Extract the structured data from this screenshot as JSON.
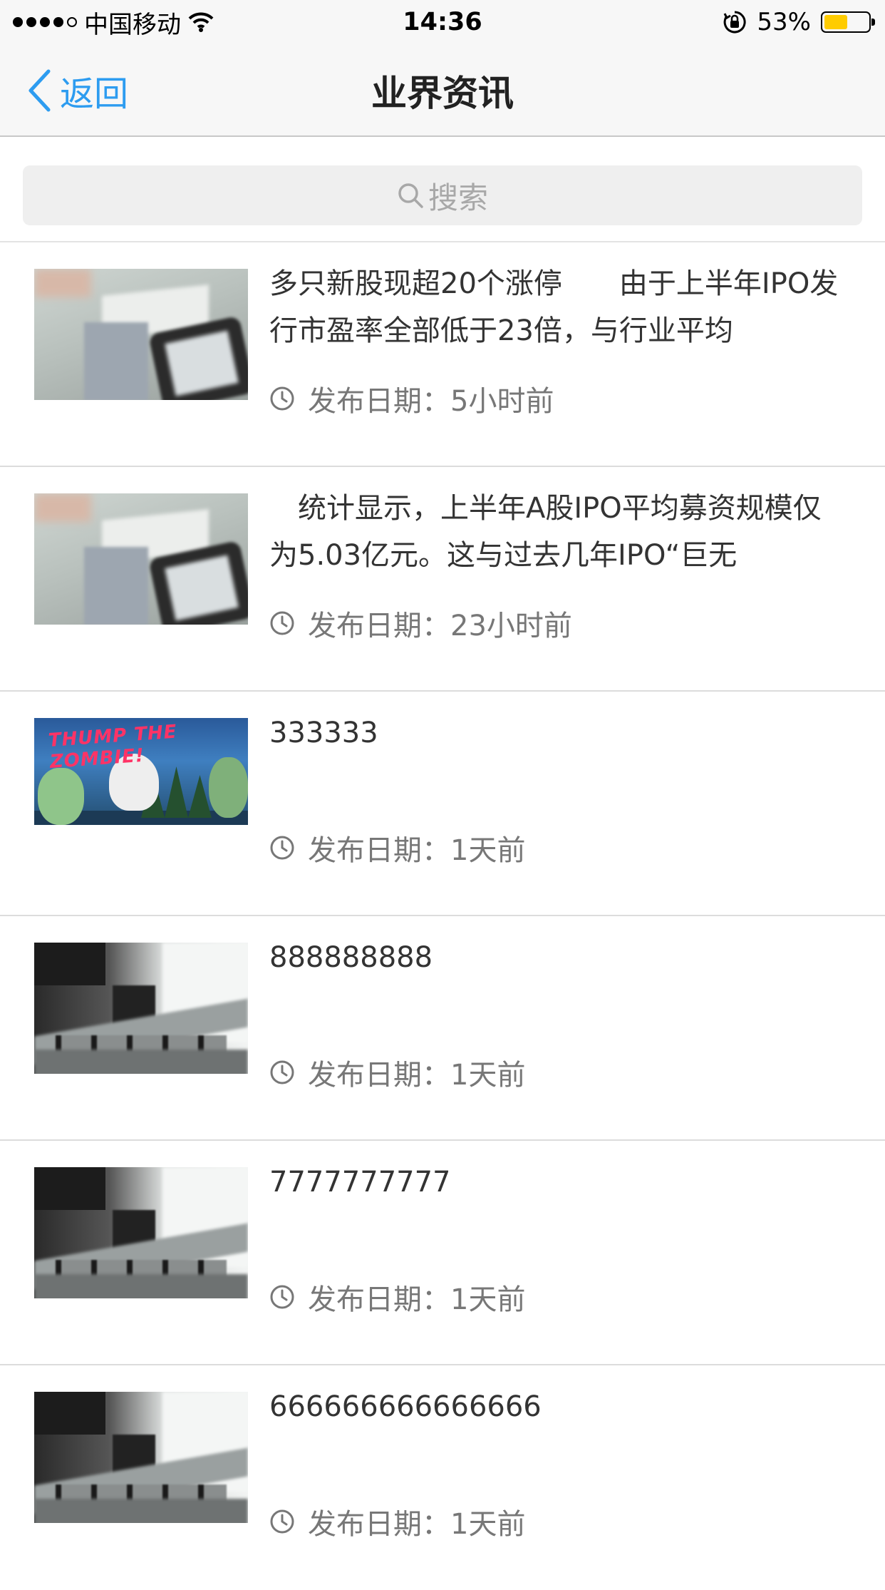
{
  "status_bar": {
    "carrier": "中国移动",
    "time": "14:36",
    "battery": "53%",
    "battery_level": 0.53
  },
  "nav": {
    "back_label": "返回",
    "title": "业界资讯"
  },
  "search": {
    "placeholder": "搜索"
  },
  "news": {
    "meta_label": "发布日期：",
    "items": [
      {
        "title": "多只新股现超20个涨停　　由于上半年IPO发行市盈率全部低于23倍，与行业平均",
        "time": "5小时前",
        "thumb": "desk-photo"
      },
      {
        "title": "　统计显示，上半年A股IPO平均募资规模仅为5.03亿元。这与过去几年IPO“巨无",
        "time": "23小时前",
        "thumb": "desk-photo"
      },
      {
        "title": "333333",
        "time": "1天前",
        "thumb": "zombie-game-art"
      },
      {
        "title": "888888888",
        "time": "1天前",
        "thumb": "office-photo"
      },
      {
        "title": "7777777777",
        "time": "1天前",
        "thumb": "office-photo"
      },
      {
        "title": "666666666666666",
        "time": "1天前",
        "thumb": "office-photo"
      }
    ]
  },
  "icons": {
    "back": "chevron-left-icon",
    "search": "search-icon",
    "clock": "clock-icon",
    "wifi": "wifi-icon",
    "lock": "rotation-lock-icon"
  },
  "colors": {
    "accent": "#2d9cf0",
    "battery": "#ffcc00"
  }
}
